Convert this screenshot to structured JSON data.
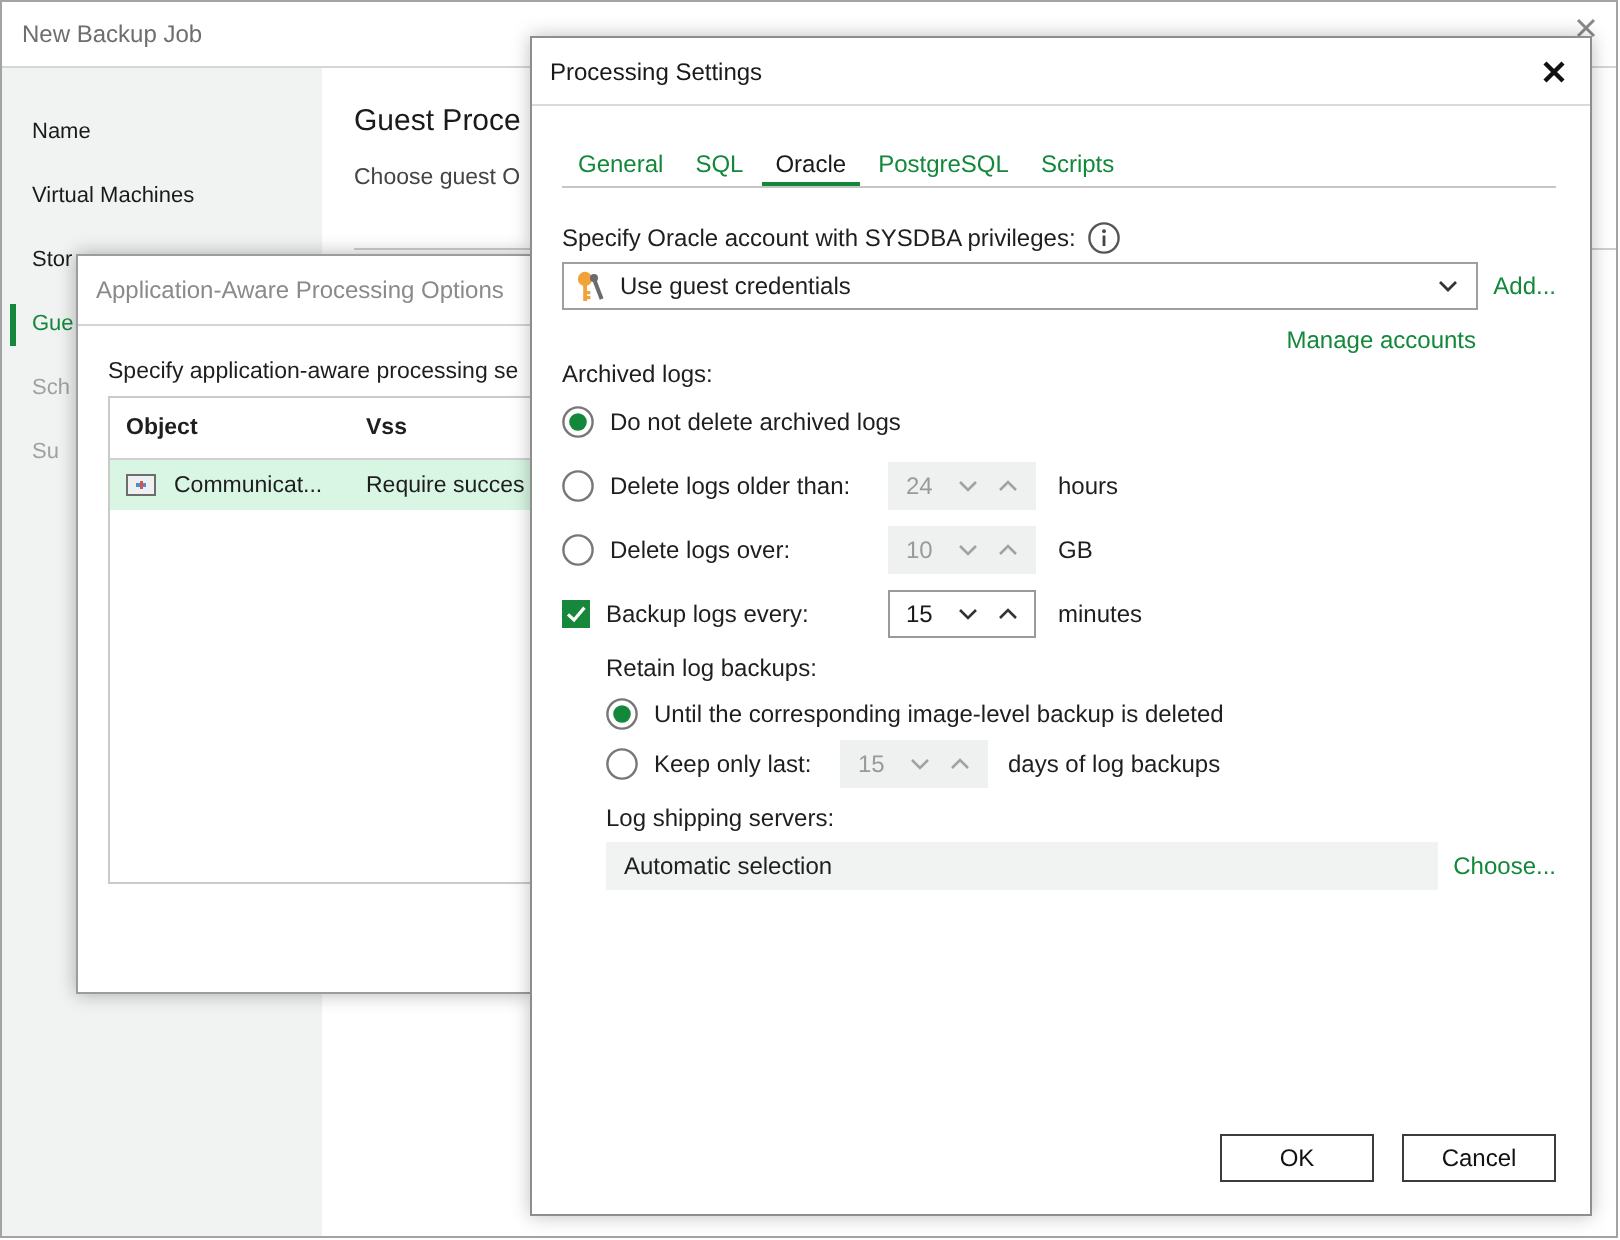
{
  "main_window": {
    "title": "New Backup Job",
    "steps": [
      {
        "label": "Name",
        "selected": false,
        "disabled": false
      },
      {
        "label": "Virtual Machines",
        "selected": false,
        "disabled": false
      },
      {
        "label": "Stor",
        "selected": false,
        "disabled": false
      },
      {
        "label": "Gue",
        "selected": true,
        "disabled": false
      },
      {
        "label": "Sch",
        "selected": false,
        "disabled": true
      },
      {
        "label": "Su",
        "selected": false,
        "disabled": true
      }
    ],
    "heading": "Guest Proce",
    "description": "Choose guest O"
  },
  "app_aware_dialog": {
    "title": "Application-Aware Processing Options",
    "instruction": "Specify application-aware processing se",
    "table": {
      "columns": [
        "Object",
        "Vss"
      ],
      "rows": [
        {
          "cells": [
            "Communicat...",
            "Require succes"
          ],
          "selected": true
        }
      ]
    }
  },
  "processing_dialog": {
    "title": "Processing Settings",
    "tabs": [
      {
        "label": "General",
        "selected": false
      },
      {
        "label": "SQL",
        "selected": false
      },
      {
        "label": "Oracle",
        "selected": true
      },
      {
        "label": "PostgreSQL",
        "selected": false
      },
      {
        "label": "Scripts",
        "selected": false
      }
    ],
    "account_label": "Specify Oracle account with SYSDBA privileges:",
    "account": "Use guest credentials",
    "add_link": "Add...",
    "manage_link": "Manage accounts",
    "archived_label": "Archived logs:",
    "archive_options": [
      {
        "kind": "radio",
        "label": "Do not delete archived logs",
        "selected": true
      },
      {
        "kind": "radio",
        "label": "Delete logs older than:",
        "selected": false,
        "spinner": {
          "value": "24",
          "disabled": true
        },
        "unit": "hours"
      },
      {
        "kind": "radio",
        "label": "Delete logs over:",
        "selected": false,
        "spinner": {
          "value": "10",
          "disabled": true
        },
        "unit": "GB"
      },
      {
        "kind": "checkbox",
        "label": "Backup logs every:",
        "checked": true,
        "spinner": {
          "value": "15",
          "disabled": false
        },
        "unit": "minutes"
      }
    ],
    "retain_label": "Retain log backups:",
    "retain_options": [
      {
        "label": "Until the corresponding image-level backup is deleted",
        "selected": true
      },
      {
        "label": "Keep only last:",
        "selected": false,
        "spinner": {
          "value": "15",
          "disabled": true
        },
        "unit": "days of log backups"
      }
    ],
    "shipping_label": "Log shipping servers:",
    "shipping_value": "Automatic selection",
    "choose_link": "Choose...",
    "buttons": [
      "OK",
      "Cancel"
    ]
  }
}
